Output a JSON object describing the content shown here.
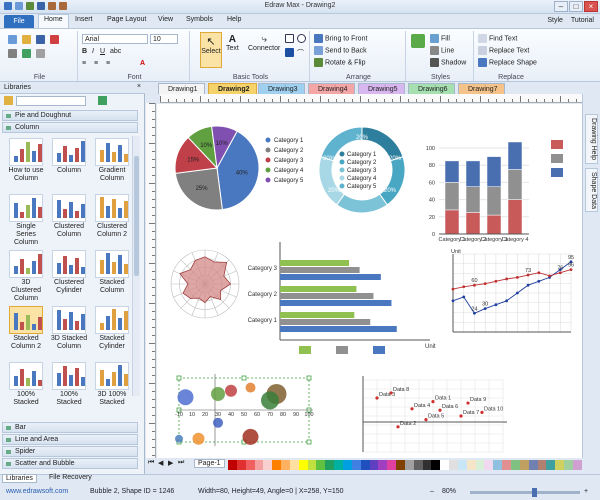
{
  "window": {
    "title": "Edraw Max - Drawing2"
  },
  "menu": {
    "file": "File",
    "tabs": [
      "Home",
      "Insert",
      "Page Layout",
      "View",
      "Symbols",
      "Help"
    ],
    "active": "Home",
    "right": [
      "Style",
      "Tutorial"
    ]
  },
  "ribbon": {
    "groups": {
      "file": "File",
      "font": "Font",
      "basic_tools": "Basic Tools",
      "arrange": "Arrange",
      "styles": "Styles",
      "replace": "Replace"
    },
    "font_name": "Arial",
    "font_size": "10",
    "tools": {
      "select": "Select",
      "text": "Text",
      "connector": "Connector"
    },
    "arrange": {
      "bring_front": "Bring to Front",
      "send_back": "Send to Back",
      "rotate_flip": "Rotate & Flip"
    },
    "styles": {
      "fill": "Fill",
      "line": "Line",
      "shadow": "Shadow"
    },
    "replace": {
      "find_text": "Find Text",
      "replace_text": "Replace Text",
      "replace_shape": "Replace Shape"
    }
  },
  "libraries": {
    "title": "Libraries",
    "categories_top": [
      "Pie and Doughnut",
      "Column"
    ],
    "shapes": [
      "How to use Column",
      "Column",
      "Gradient Column",
      "Single Series Column",
      "Clustered Column",
      "Clustered Column 2",
      "3D Clustered Column",
      "Clustered Cylinder",
      "Stacked Column",
      "Stacked Column 2",
      "3D Stacked Column",
      "Stacked Cylinder",
      "100% Stacked",
      "100% Stacked",
      "3D 100% Stacked"
    ],
    "selected_index": 9,
    "categories_bottom": [
      "Bar",
      "Line and Area",
      "Spider",
      "Scatter and Bubble"
    ],
    "bottom_tabs": [
      "Libraries",
      "File Recovery"
    ]
  },
  "doc_tabs": [
    "Drawing1",
    "Drawing2",
    "Drawing3",
    "Drawing4",
    "Drawing5",
    "Drawing6",
    "Drawing7"
  ],
  "doc_tab_colors": [
    "#f4f4f4",
    "#f6d36a",
    "#9fd0f0",
    "#f4a6a6",
    "#d8b6f0",
    "#a6e0b0",
    "#f5c28a"
  ],
  "active_doc": 1,
  "right_panel": [
    "Drawing Help",
    "Shape Data"
  ],
  "page": {
    "tab": "Page-1"
  },
  "status": {
    "website": "www.edrawsoft.com",
    "shape_info": "Bubble 2, Shape ID = 1246",
    "geometry": "Width=80, Height=49, Angle=0 | X=258, Y=150",
    "zoom": "80%"
  },
  "palette": [
    "#c00000",
    "#e03030",
    "#f06060",
    "#f4a0a0",
    "#f9d0d0",
    "#ff8000",
    "#ffb060",
    "#ffe0a0",
    "#ffff00",
    "#c0e040",
    "#60c040",
    "#20a060",
    "#00b0a0",
    "#00a0e0",
    "#4080e0",
    "#2050c0",
    "#6040c0",
    "#a040c0",
    "#e040a0",
    "#804000",
    "#a0a0a0",
    "#606060",
    "#303030",
    "#000000",
    "#ffffff",
    "#e0e0e0",
    "#c8e6f5",
    "#f5e6c8",
    "#d8f0d8",
    "#f0d8f0",
    "#90c0e0",
    "#e09090",
    "#80c080",
    "#c0a060",
    "#7080b0",
    "#b08070",
    "#40a0a0",
    "#d0d060",
    "#a0d0a0",
    "#d0a0d0"
  ],
  "charts": {
    "pie": {
      "type": "pie",
      "values": [
        40,
        25,
        15,
        10,
        10
      ],
      "labels": [
        "40%",
        "25%",
        "15%",
        "10%",
        "10%"
      ],
      "legend": [
        "Category 1",
        "Category 2",
        "Category 3",
        "Category 4",
        "Category 5"
      ],
      "colors": [
        "#4a78c0",
        "#808080",
        "#c0404a",
        "#60a040",
        "#8050b0"
      ]
    },
    "doughnut": {
      "type": "pie",
      "values": [
        20,
        20,
        20,
        20,
        20
      ],
      "labels": [
        "20%",
        "20%",
        "20%",
        "20%",
        "20%"
      ],
      "legend": [
        "Category 1",
        "Category 2",
        "Category 3",
        "Category 4",
        "Category 5"
      ],
      "colors": [
        "#2e7f9e",
        "#4aa7c4",
        "#7cc3d8",
        "#a8d8e6",
        "#5fb3cf"
      ]
    },
    "stacked_column": {
      "type": "bar",
      "categories": [
        "Category 1",
        "Category 2",
        "Category 3",
        "Category 4"
      ],
      "ticks": [
        "100",
        "80",
        "60",
        "40",
        "20",
        "0"
      ],
      "series": [
        {
          "values": [
            28,
            25,
            22,
            40
          ]
        },
        {
          "values": [
            32,
            30,
            33,
            35
          ]
        },
        {
          "values": [
            25,
            30,
            35,
            32
          ]
        }
      ],
      "colors": [
        "#c85a5a",
        "#909090",
        "#4a6fb0"
      ],
      "ylim": [
        0,
        100
      ]
    },
    "spider": {
      "type": "other"
    },
    "hbar": {
      "type": "bar",
      "categories": [
        "Category 1",
        "Category 2",
        "Category 3"
      ],
      "series": [
        {
          "values": [
            110,
            105,
            95
          ]
        },
        {
          "values": [
            85,
            88,
            75
          ]
        },
        {
          "values": [
            70,
            72,
            65
          ]
        }
      ],
      "colors": [
        "#4a78c0",
        "#909090",
        "#90c050"
      ],
      "legend_colors": [
        "#90c050",
        "#909090",
        "#4a78c0"
      ],
      "unit": "Unit",
      "xlim": [
        0,
        130
      ]
    },
    "line": {
      "type": "line",
      "title": "Unit",
      "series": [
        {
          "values": [
            40,
            45,
            24,
            30,
            35,
            40,
            50,
            60,
            65,
            70,
            80,
            90
          ],
          "color": "#2040a0",
          "labels": [
            "",
            "",
            "24",
            "30",
            "",
            "",
            "",
            "",
            "",
            "",
            "",
            "95"
          ]
        },
        {
          "values": [
            55,
            58,
            60,
            62,
            65,
            68,
            70,
            73,
            76,
            72,
            76,
            80
          ],
          "color": "#c03030",
          "labels": [
            "",
            "",
            "60",
            "",
            "",
            "",
            "",
            "73",
            "",
            "",
            "76",
            "96"
          ]
        }
      ],
      "ylim": [
        0,
        100
      ]
    },
    "bubble": {
      "type": "scatter",
      "axis_labels": [
        "-10",
        "10",
        "20",
        "30",
        "40",
        "50",
        "60",
        "70",
        "80",
        "90",
        "100"
      ],
      "bubbles": [
        {
          "x": 5,
          "y": 70,
          "r": 8,
          "color": "#5070d0"
        },
        {
          "x": 30,
          "y": 75,
          "r": 7,
          "color": "#60a040"
        },
        {
          "x": 40,
          "y": 80,
          "r": 6,
          "color": "#c04040"
        },
        {
          "x": 75,
          "y": 75,
          "r": 10,
          "color": "#806030"
        },
        {
          "x": 70,
          "y": 65,
          "r": 9,
          "color": "#3a7f3a"
        },
        {
          "x": 55,
          "y": 85,
          "r": 5,
          "color": "#e08030"
        },
        {
          "x": 30,
          "y": 30,
          "r": 5,
          "color": "#4060c0"
        },
        {
          "x": 15,
          "y": 5,
          "r": 6,
          "color": "#f09030"
        },
        {
          "x": 55,
          "y": 8,
          "r": 8,
          "color": "#a03020"
        },
        {
          "x": 0,
          "y": 5,
          "r": 4,
          "color": "#5080c0"
        }
      ]
    },
    "scatter": {
      "type": "scatter",
      "points": [
        {
          "x": 2,
          "y": 8.2,
          "label": "Data 8"
        },
        {
          "x": 1,
          "y": 7.5,
          "label": "Data 3"
        },
        {
          "x": 5,
          "y": 7,
          "label": "Data 1"
        },
        {
          "x": 7.5,
          "y": 6.8,
          "label": "Data 9"
        },
        {
          "x": 3.5,
          "y": 6,
          "label": "Data 4"
        },
        {
          "x": 5.5,
          "y": 5.8,
          "label": "Data 6"
        },
        {
          "x": 7,
          "y": 5,
          "label": "Data 7"
        },
        {
          "x": 8.5,
          "y": 5.5,
          "label": "Data 10"
        },
        {
          "x": 4.5,
          "y": 4.5,
          "label": "Data 5"
        },
        {
          "x": 2.5,
          "y": 3.5,
          "label": "Data 2"
        }
      ]
    }
  }
}
